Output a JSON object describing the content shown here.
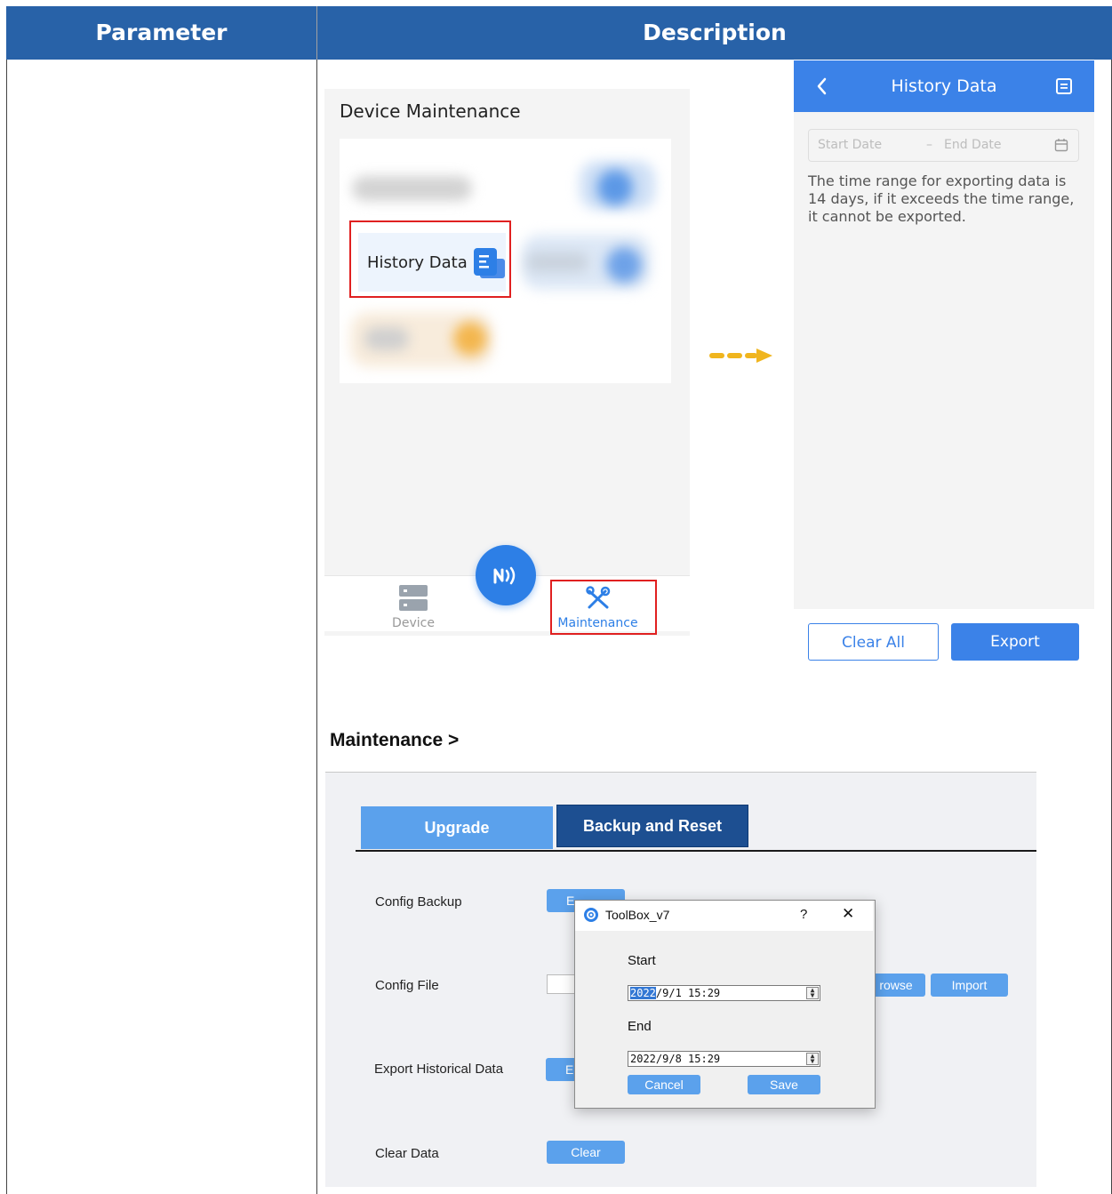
{
  "table": {
    "headers": [
      "Parameter",
      "Description"
    ]
  },
  "mobile_app": {
    "maintenance_screen": {
      "title": "Device Maintenance",
      "history_item_label": "History Data",
      "nav": {
        "device_label": "Device",
        "maintenance_label": "Maintenance"
      }
    },
    "history_screen": {
      "title": "History Data",
      "start_placeholder": "Start Date",
      "end_placeholder": "End Date",
      "range_separator": "–",
      "note": "The time range for exporting data is 14 days, if it exceeds the time range, it cannot be exported.",
      "clear_all_label": "Clear All",
      "export_label": "Export"
    }
  },
  "web_ui": {
    "title": "Maintenance >",
    "tabs": [
      {
        "label": "Upgrade",
        "active": false
      },
      {
        "label": "Backup and Reset",
        "active": true
      }
    ],
    "rows": [
      {
        "label": "Config Backup",
        "button": "Export"
      },
      {
        "label": "Config File",
        "browse": "Browse",
        "import": "Import"
      },
      {
        "label": "Export Historical Data",
        "button": "Export"
      },
      {
        "label": "Clear Data",
        "button": "Clear"
      }
    ],
    "visible_fragments": {
      "config_backup_btn": "E",
      "browse_btn": "rowse",
      "export_hist_btn": "E"
    }
  },
  "dialog": {
    "title": "ToolBox_v7",
    "help": "?",
    "close": "✕",
    "start_label": "Start",
    "start_year": "2022",
    "start_rest": "/9/1 15:29",
    "end_label": "End",
    "end_value": "2022/9/8 15:29",
    "cancel_label": "Cancel",
    "save_label": "Save"
  },
  "colors": {
    "table_header": "#2862a8",
    "app_blue": "#3b82e8",
    "web_button": "#5ba1ec",
    "web_tab_active": "#1d4f91",
    "highlight_red": "#e02020",
    "arrow_orange": "#f0b51e"
  }
}
